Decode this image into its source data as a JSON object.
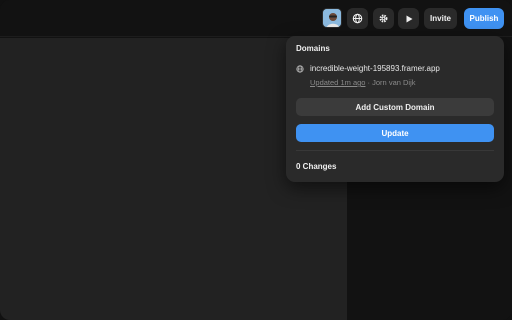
{
  "toolbar": {
    "avatar_icon": "user-avatar",
    "globe_icon": "globe-icon",
    "settings_icon": "gear-icon",
    "preview_icon": "play-icon",
    "invite_label": "Invite",
    "publish_label": "Publish",
    "accent_color": "#3f92f2"
  },
  "publish_panel": {
    "title": "Domains",
    "domain": "incredible-weight-195893.framer.app",
    "updated_label": "Updated 1m ago",
    "separator": " · ",
    "updated_by": "Jorn van Dijk",
    "add_custom_domain_label": "Add Custom Domain",
    "update_label": "Update",
    "changes_label": "0 Changes"
  }
}
